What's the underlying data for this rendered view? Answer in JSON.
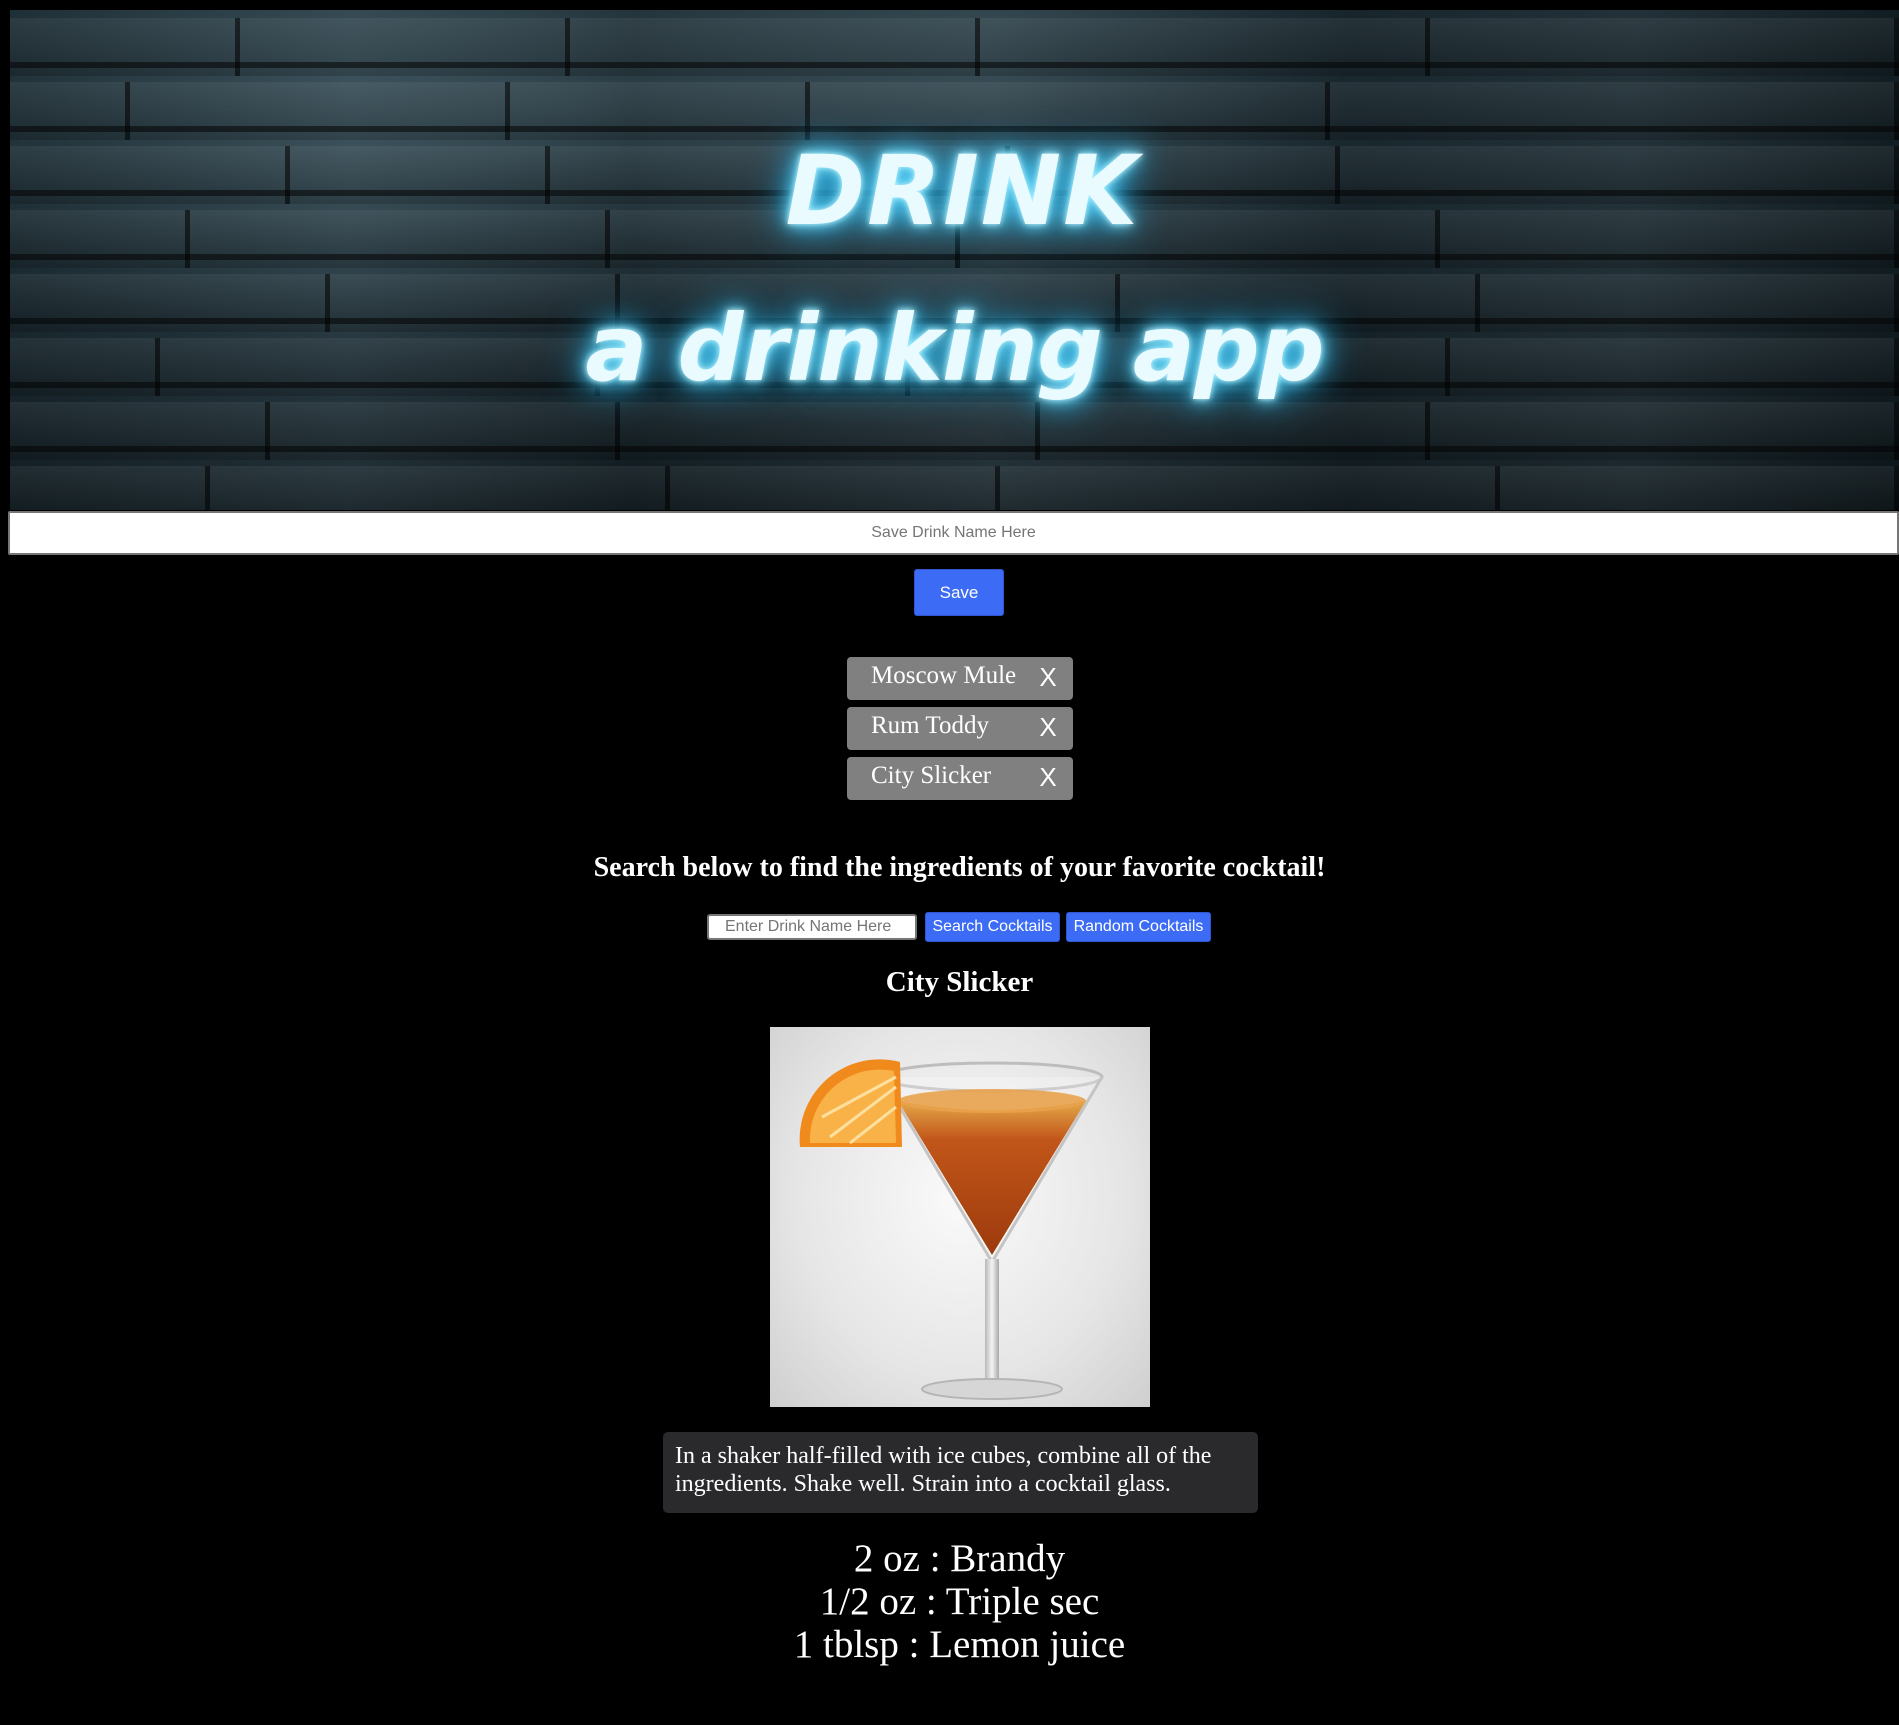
{
  "hero": {
    "title": "DRINK",
    "subtitle": "a drinking app"
  },
  "save": {
    "placeholder": "Save Drink Name Here",
    "value": "",
    "button_label": "Save"
  },
  "saved_drinks": [
    {
      "name": "Moscow Mule",
      "remove_label": "X"
    },
    {
      "name": "Rum Toddy",
      "remove_label": "X"
    },
    {
      "name": "City Slicker",
      "remove_label": "X"
    }
  ],
  "search": {
    "heading": "Search below to find the ingredients of your favorite cocktail!",
    "placeholder": "Enter Drink Name Here",
    "value": "",
    "search_button_label": "Search Cocktails",
    "random_button_label": "Random Cocktails"
  },
  "result": {
    "name": "City Slicker",
    "image_alt": "cocktail-image",
    "instructions": "In a shaker half-filled with ice cubes, combine all of the ingredients. Shake well. Strain into a cocktail glass.",
    "ingredients": [
      {
        "measure": "2 oz",
        "name": "Brandy"
      },
      {
        "measure": "1/2 oz",
        "name": "Triple sec"
      },
      {
        "measure": "1 tblsp",
        "name": "Lemon juice"
      }
    ]
  },
  "colors": {
    "background": "#000000",
    "accent_blue": "#3c6cf5",
    "saved_item_gray": "#808080",
    "neon_glow": "#7fe6ff",
    "instructions_bg": "#2a2a2d"
  }
}
